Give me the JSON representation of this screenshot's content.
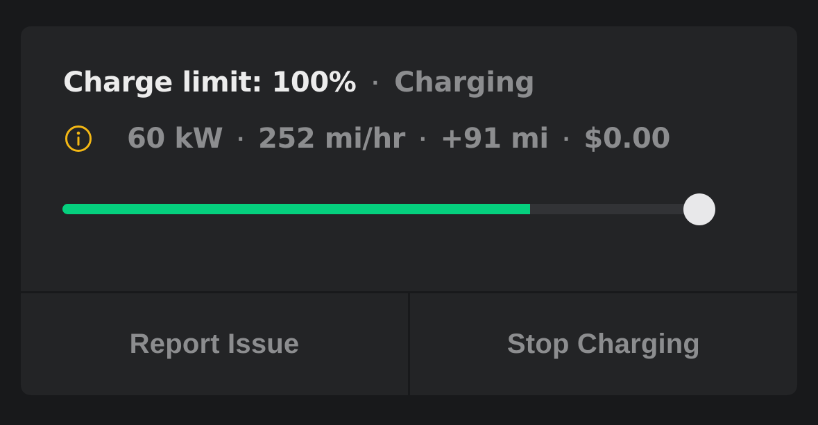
{
  "status": {
    "charge_limit_text": "Charge limit: 100%",
    "separator": "·",
    "state_text": "Charging"
  },
  "stats": {
    "info_icon": "info-icon",
    "power": "60 kW",
    "rate": "252 mi/hr",
    "added_range": "+91 mi",
    "cost": "$0.00",
    "separator": "·"
  },
  "charge_bar": {
    "current_level_fraction": 0.717,
    "limit_fraction": 1.0,
    "fill_color": "#05d07e",
    "info_icon_color": "#f4b814"
  },
  "actions": {
    "report_label": "Report Issue",
    "stop_label": "Stop Charging"
  }
}
